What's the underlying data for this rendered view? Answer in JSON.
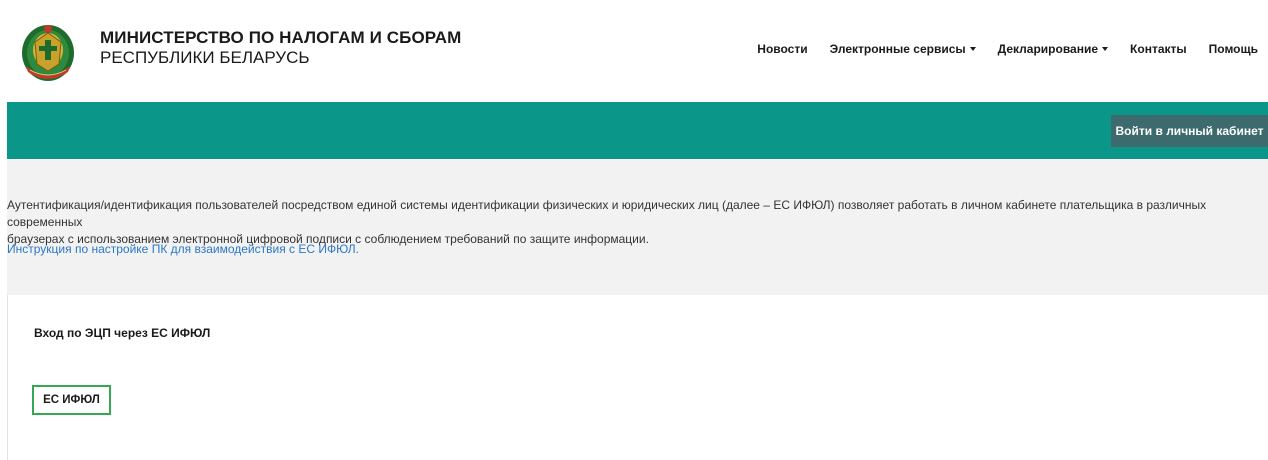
{
  "header": {
    "title_line1": "МИНИСТЕРСТВО ПО НАЛОГАМ И СБОРАМ",
    "title_line2": "РЕСПУБЛИКИ БЕЛАРУСЬ",
    "logo_icon": "ministry-emblem-icon"
  },
  "nav": {
    "items": [
      {
        "label": "Новости"
      },
      {
        "label": "Электронные сервисы"
      },
      {
        "label": "Декларирование"
      },
      {
        "label": "Контакты"
      },
      {
        "label": "Помощь"
      }
    ]
  },
  "band": {
    "login_label": "Войти в личный кабинет",
    "color": "#0a9688"
  },
  "info": {
    "text_line1": "Аутентификация/идентификация пользователей посредством единой системы идентификации физических и юридических лиц (далее – ЕС ИФЮЛ) позволяет работать в личном кабинете плательщика в различных современных",
    "text_line2": "браузерах с использованием электронной цифровой подписи с соблюдением требований по защите информации.",
    "link_text": "Инструкция по настройке ПК для взаимодействия с ЕС ИФЮЛ."
  },
  "panel": {
    "title": "Вход по ЭЦП через ЕС ИФЮЛ",
    "button_label": "ЕС ИФЮЛ",
    "button_border_color": "#34a853"
  }
}
